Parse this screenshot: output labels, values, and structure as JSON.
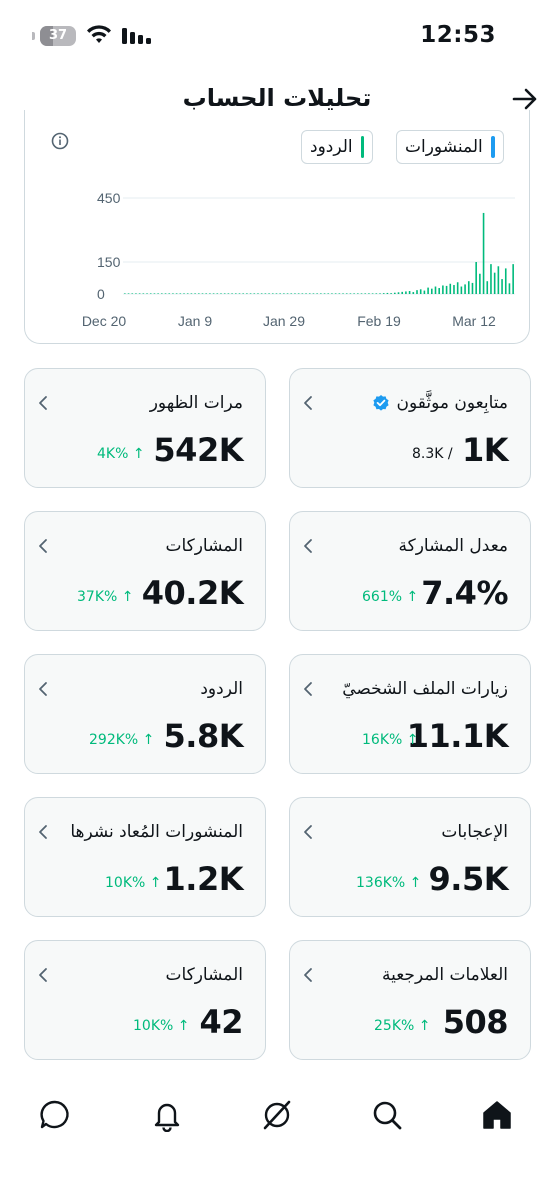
{
  "status_bar": {
    "time": "12:53",
    "battery": "37",
    "battery_level": 0.37,
    "icons": [
      "wifi-icon",
      "cellular-signal-icon"
    ]
  },
  "header": {
    "title": "تحليلات الحساب",
    "back_icon": "arrow-right-icon"
  },
  "chart": {
    "legend": [
      {
        "label": "المنشورات",
        "color": "#1d9bf0"
      },
      {
        "label": "الردود",
        "color": "#00ba7c"
      }
    ],
    "info_icon": "info-icon"
  },
  "chart_data": {
    "type": "bar",
    "x_tick_labels": [
      "Dec 20",
      "Jan 9",
      "Jan 29",
      "Feb 19",
      "Mar 12"
    ],
    "y_tick_labels": [
      "450",
      "150",
      "0"
    ],
    "ylim": [
      0,
      450
    ],
    "grid": true,
    "series": [
      {
        "name": "الردود",
        "color": "#00ba7c",
        "values": [
          0,
          0,
          0,
          0,
          0,
          0,
          0,
          0,
          0,
          0,
          0,
          0,
          0,
          0,
          0,
          0,
          0,
          0,
          0,
          0,
          0,
          0,
          0,
          0,
          0,
          0,
          0,
          0,
          0,
          0,
          0,
          0,
          0,
          0,
          0,
          0,
          0,
          0,
          0,
          0,
          0,
          0,
          0,
          0,
          0,
          0,
          0,
          0,
          0,
          0,
          0,
          0,
          0,
          0,
          0,
          0,
          1,
          0,
          1,
          1,
          0,
          1,
          2,
          1,
          2,
          2,
          3,
          2,
          3,
          3,
          4,
          5,
          4,
          6,
          8,
          10,
          12,
          14,
          9,
          18,
          22,
          16,
          30,
          25,
          35,
          28,
          40,
          38,
          48,
          42,
          55,
          35,
          45,
          60,
          52,
          150,
          95,
          380,
          60,
          140,
          100,
          130,
          70,
          120,
          50,
          140
        ]
      }
    ]
  },
  "stats": [
    {
      "label": "متابِعون موثَّقون",
      "value": "1K",
      "sub": "8.3K /",
      "change": null,
      "verified": true
    },
    {
      "label": "مرات الظهور",
      "value": "542K",
      "change": "4K% ↑"
    },
    {
      "label": "معدل المشاركة",
      "value": "7.4%",
      "change": "661% ↑"
    },
    {
      "label": "المشاركات",
      "value": "40.2K",
      "change": "37K% ↑"
    },
    {
      "label": "زيارات الملف الشخصيّ",
      "value": "11.1K",
      "change": "16K% ↑"
    },
    {
      "label": "الردود",
      "value": "5.8K",
      "change": "292K% ↑"
    },
    {
      "label": "الإعجابات",
      "value": "9.5K",
      "change": "136K% ↑"
    },
    {
      "label": "المنشورات المُعاد نشرها",
      "value": "1.2K",
      "change": "10K% ↑"
    },
    {
      "label": "العلامات المرجعية",
      "value": "508",
      "change": "25K% ↑"
    },
    {
      "label": "المشاركات",
      "value": "42",
      "change": "10K% ↑"
    }
  ],
  "bottom_nav": [
    "home-icon",
    "search-icon",
    "grok-icon",
    "notifications-icon",
    "messages-icon"
  ]
}
